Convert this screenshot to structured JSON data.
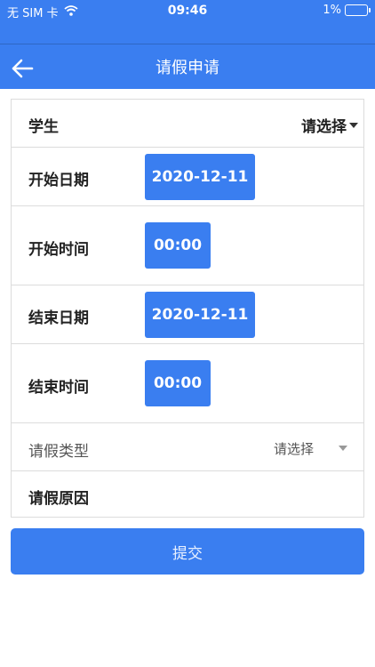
{
  "status_bar": {
    "carrier": "无 SIM 卡",
    "time": "09:46",
    "battery": "1%"
  },
  "nav": {
    "title": "请假申请"
  },
  "form": {
    "student": {
      "label": "学生",
      "value": "请选择"
    },
    "start_date": {
      "label": "开始日期",
      "value": "2020-12-11"
    },
    "start_time": {
      "label": "开始时间",
      "value": "00:00"
    },
    "end_date": {
      "label": "结束日期",
      "value": "2020-12-11"
    },
    "end_time": {
      "label": "结束时间",
      "value": "00:00"
    },
    "leave_type": {
      "label": "请假类型",
      "value": "请选择"
    },
    "leave_reason": {
      "label": "请假原因"
    }
  },
  "submit_label": "提交",
  "colors": {
    "primary": "#3a7ef0",
    "border": "#dcdcdc"
  },
  "icons": [
    "wifi-icon",
    "battery-icon",
    "back-arrow-icon",
    "caret-down-icon"
  ]
}
